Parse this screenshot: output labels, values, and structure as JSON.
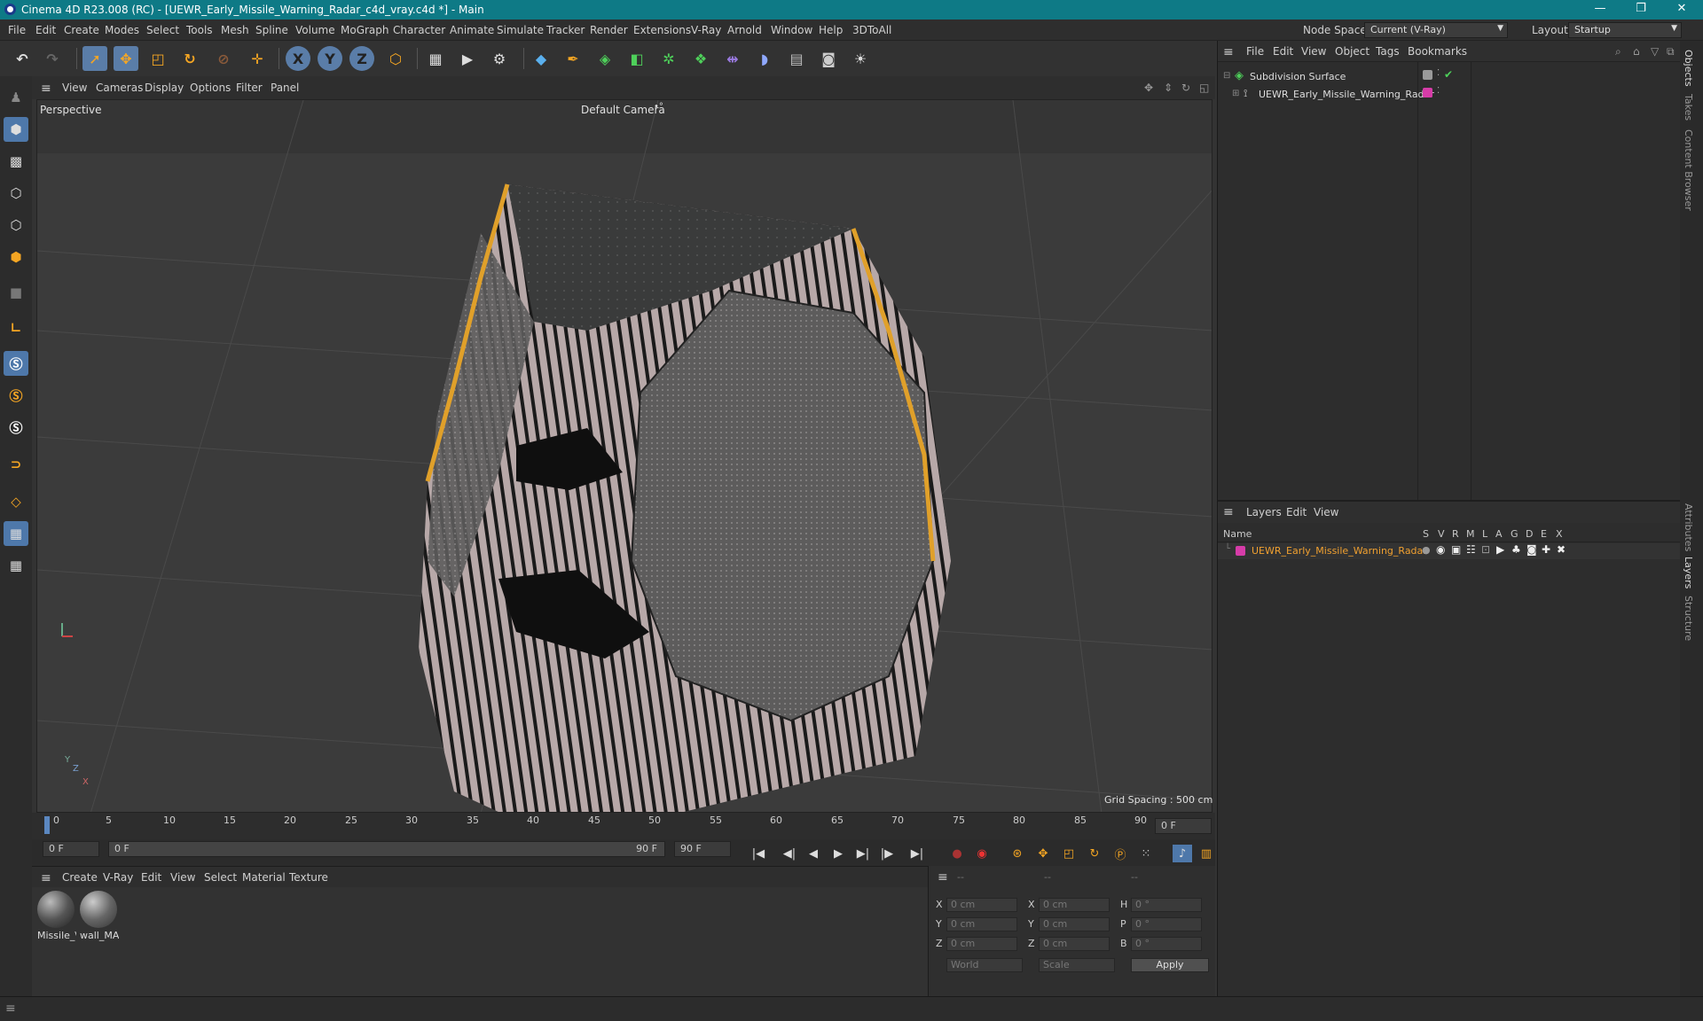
{
  "window": {
    "title": "Cinema 4D R23.008 (RC) - [UEWR_Early_Missile_Warning_Radar_c4d_vray.c4d *] - Main",
    "controls": [
      "—",
      "❐",
      "✕"
    ]
  },
  "menubar": {
    "items": [
      "File",
      "Edit",
      "Create",
      "Modes",
      "Select",
      "Tools",
      "Mesh",
      "Spline",
      "Volume",
      "MoGraph",
      "Character",
      "Animate",
      "Simulate",
      "Tracker",
      "Render",
      "Extensions",
      "V-Ray",
      "Arnold",
      "Window",
      "Help",
      "3DToAll"
    ],
    "node_space_label": "Node Space:",
    "node_space_value": "Current (V-Ray)",
    "layout_label": "Layout:",
    "layout_value": "Startup"
  },
  "toolbar": {
    "icons": [
      "undo-icon",
      "redo-icon",
      "select-icon",
      "move-icon",
      "scale-icon",
      "rotate-icon",
      "recent-icon",
      "add-icon",
      "x-axis-icon",
      "y-axis-icon",
      "z-axis-icon",
      "coord-system-icon",
      "render-region-icon",
      "render-view-icon",
      "render-settings-icon",
      "cube-icon",
      "pen-icon",
      "subdivision-icon",
      "extrude-icon",
      "mograph-icon",
      "array-icon",
      "deformer-icon",
      "field-icon",
      "floor-icon",
      "camera-icon",
      "light-icon"
    ],
    "axis_x": "X",
    "axis_y": "Y",
    "axis_z": "Z"
  },
  "viewport": {
    "menu": [
      "View",
      "Cameras",
      "Display",
      "Options",
      "Filter",
      "Panel"
    ],
    "label": "Perspective",
    "camera": "Default Camera",
    "camera_suffix": "•°",
    "grid_spacing": "Grid Spacing : 500 cm",
    "axis_y": "Y",
    "axis_z": "Z",
    "axis_x": "X"
  },
  "timeline": {
    "ticks": [
      "0",
      "5",
      "10",
      "15",
      "20",
      "25",
      "30",
      "35",
      "40",
      "45",
      "50",
      "55",
      "60",
      "65",
      "70",
      "75",
      "80",
      "85",
      "90"
    ],
    "current_frame": "0 F"
  },
  "transport": {
    "start": "0 F",
    "range_start": "0 F",
    "range_end": "90 F",
    "end": "90 F",
    "buttons": [
      "|◀",
      "◀|",
      "◀",
      "▶",
      "▶|",
      "|▶",
      "▶|"
    ]
  },
  "material_panel": {
    "menu": [
      "Create",
      "V-Ray",
      "Edit",
      "View",
      "Select",
      "Material",
      "Texture"
    ],
    "materials": [
      {
        "name": "Missile_\\"
      },
      {
        "name": "wall_MA"
      }
    ]
  },
  "coord_panel": {
    "headers": [
      "--",
      "--",
      "--"
    ],
    "rows": [
      {
        "a": "X",
        "av": "0 cm",
        "b": "X",
        "bv": "0 cm",
        "c": "H",
        "cv": "0 °"
      },
      {
        "a": "Y",
        "av": "0 cm",
        "b": "Y",
        "bv": "0 cm",
        "c": "P",
        "cv": "0 °"
      },
      {
        "a": "Z",
        "av": "0 cm",
        "b": "Z",
        "bv": "0 cm",
        "c": "B",
        "cv": "0 °"
      }
    ],
    "mode": "World",
    "transform": "Scale",
    "apply": "Apply"
  },
  "object_panel": {
    "menu": [
      "File",
      "Edit",
      "View",
      "Object",
      "Tags",
      "Bookmarks"
    ],
    "objects": [
      {
        "name": "Subdivision Surface"
      },
      {
        "name": "UEWR_Early_Missile_Warning_Radar"
      }
    ],
    "layer_color": "#d63ca8"
  },
  "layer_panel": {
    "menu": [
      "Layers",
      "Edit",
      "View"
    ],
    "col_name": "Name",
    "cols": [
      "S",
      "V",
      "R",
      "M",
      "L",
      "A",
      "G",
      "D",
      "E",
      "X"
    ],
    "layer_name": "UEWR_Early_Missile_Warning_Radar"
  },
  "right_tabs": [
    "Objects",
    "Takes",
    "Content Browser",
    "Attributes",
    "Layers",
    "Structure"
  ]
}
